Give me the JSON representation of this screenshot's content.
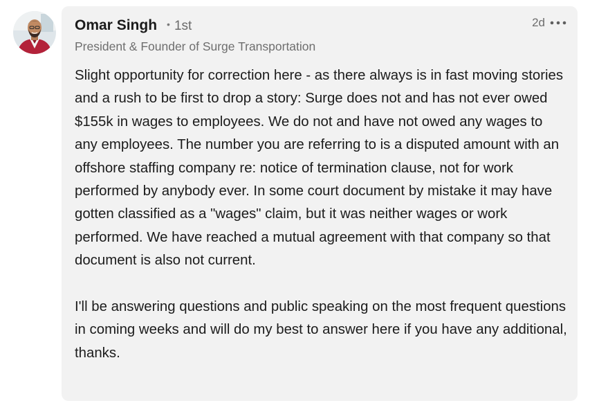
{
  "comment": {
    "author": {
      "name": "Omar Singh",
      "connection_degree": "1st",
      "degree_separator": "•",
      "headline": "President & Founder of Surge Transportation",
      "avatar_icon": "profile-photo"
    },
    "timestamp": "2d",
    "more_icon": "more-horizontal-icon",
    "paragraphs": [
      "Slight opportunity for correction here - as there always is in fast moving stories and a rush to be first to drop a story: Surge does not and has not ever owed $155k in wages to employees. We do not and have not owed any wages to any employees. The number you are referring to is a disputed amount with an offshore staffing company re: notice of termination clause, not for work performed by anybody ever. In some court document by mistake it may have gotten classified as a \"wages\" claim, but it was neither wages or work performed. We have reached a mutual agreement with that company so that document is also not current.",
      "I'll be answering questions and public speaking on the most frequent questions in coming weeks and will do my best to answer here if you have any additional, thanks."
    ]
  },
  "colors": {
    "bubble_background": "#f2f2f2",
    "primary_text": "#1b1b1b",
    "secondary_text": "#6e6e6e"
  }
}
